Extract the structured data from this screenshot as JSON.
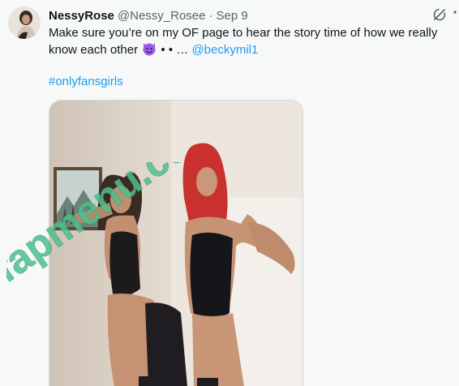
{
  "tweet": {
    "display_name": "NessyRose",
    "handle": "@Nessy_Rosee",
    "separator": "·",
    "timestamp": "Sep 9",
    "text_main": "Make sure you’re on my OF page to hear the story time of how we really know each other",
    "text_dots": "• • …",
    "mention": "@beckymil1",
    "hashtag": "#onlyfansgirls"
  },
  "icons": {
    "grok": "grok-icon",
    "more": "more-vertical-icon",
    "emoji": "smiling-devil-emoji"
  },
  "watermark": {
    "text": "fapmenu.com"
  },
  "colors": {
    "link": "#1d9bf0",
    "secondary_text": "#536471",
    "watermark_green": "#4fc08d"
  }
}
